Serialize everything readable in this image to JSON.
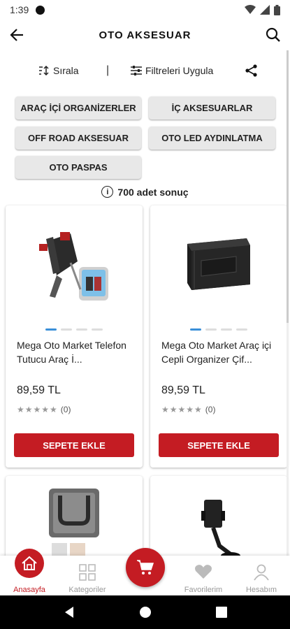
{
  "status": {
    "time": "1:39"
  },
  "header": {
    "title": "OTO AKSESUAR"
  },
  "toolbar": {
    "sort_label": "Sırala",
    "separator": "|",
    "filter_label": "Filtreleri Uygula"
  },
  "chips": [
    "ARAÇ İÇİ ORGANİZERLER",
    "İÇ AKSESUARLAR",
    "OFF ROAD AKSESUAR",
    "OTO LED AYDINLATMA",
    "OTO PASPAS"
  ],
  "results": {
    "text": "700 adet sonuç"
  },
  "products": [
    {
      "name": "Mega Oto Market Telefon Tutucu Araç İ...",
      "price": "89,59 TL",
      "rating": "★★★★★",
      "reviews": "(0)",
      "button": "SEPETE EKLE"
    },
    {
      "name": "Mega Oto Market Araç içi Cepli Organizer Çif...",
      "price": "89,59 TL",
      "rating": "★★★★★",
      "reviews": "(0)",
      "button": "SEPETE EKLE"
    }
  ],
  "bottom_nav": {
    "home": "Anasayfa",
    "categories": "Kategoriler",
    "favorites": "Favorilerim",
    "account": "Hesabım"
  },
  "colors": {
    "accent": "#c41c23",
    "dot_active": "#3a8fd8"
  }
}
